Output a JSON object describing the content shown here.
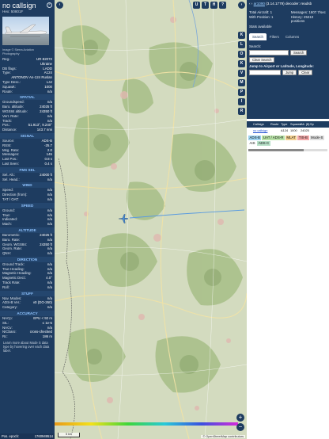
{
  "detail": {
    "callsign": "no callsign",
    "hex": "Hex: 50801F",
    "close_icon": "close-icon",
    "photo_credit": "Image © Sierra Aviation Photography",
    "info_rows": [
      {
        "k": "Reg.:",
        "v": "UR-82072"
      },
      {
        "k": "",
        "v": "Ukraine"
      },
      {
        "k": "DB flags:",
        "v": "LADD"
      },
      {
        "k": "Type:",
        "v": "A124"
      },
      {
        "k": "",
        "v": "ANTONOV An-124 Ruslan"
      },
      {
        "k": "Type Desc.:",
        "v": "L4J"
      },
      {
        "k": "Squawk:",
        "v": "1000"
      },
      {
        "k": "Route:",
        "v": "n/a"
      }
    ],
    "sections": [
      {
        "title": "SPATIAL",
        "rows": [
          {
            "k": "Groundspeed:",
            "v": "n/a"
          },
          {
            "k": "Baro. altitude:",
            "v": "24025 ft"
          },
          {
            "k": "WGS84 altitude:",
            "v": "24350 ft"
          },
          {
            "k": "Vert. Rate:",
            "v": "n/a"
          },
          {
            "k": "Track:",
            "v": "n/a"
          },
          {
            "k": "Pos.:",
            "v": "51.913°, 9.240°"
          },
          {
            "k": "Distance:",
            "v": "143.7 nmi"
          }
        ]
      },
      {
        "title": "SIGNAL",
        "rows": [
          {
            "k": "Source:",
            "v": "ADS-B"
          },
          {
            "k": "RSSI:",
            "v": "-25.7"
          },
          {
            "k": "Msg. Rate:",
            "v": "2.0"
          },
          {
            "k": "Messages:",
            "v": "145"
          },
          {
            "k": "Last Pos.:",
            "v": "0.8 s"
          },
          {
            "k": "Last Seen:",
            "v": "0.4 s"
          }
        ]
      },
      {
        "title": "FMS SEL",
        "rows": [
          {
            "k": "Sel. Alt.:",
            "v": "24000 ft"
          },
          {
            "k": "Sel. Head.:",
            "v": "n/a"
          }
        ]
      },
      {
        "title": "WIND",
        "rows": [
          {
            "k": "Speed:",
            "v": "n/a"
          },
          {
            "k": "Direction (from):",
            "v": "n/a"
          },
          {
            "k": "TAT / OAT:",
            "v": "n/a"
          }
        ]
      },
      {
        "title": "SPEED",
        "rows": [
          {
            "k": "Ground:",
            "v": "n/a"
          },
          {
            "k": "True:",
            "v": "n/a"
          },
          {
            "k": "Indicated:",
            "v": "n/a"
          },
          {
            "k": "Mach:",
            "v": "n/a"
          }
        ]
      },
      {
        "title": "ALTITUDE",
        "rows": [
          {
            "k": "Barometric:",
            "v": "24025 ft"
          },
          {
            "k": "Baro. Rate:",
            "v": "n/a"
          },
          {
            "k": "Geom. WGS84:",
            "v": "24350 ft"
          },
          {
            "k": "Geom. Rate:",
            "v": "n/a"
          },
          {
            "k": "QNH:",
            "v": "n/a"
          }
        ]
      },
      {
        "title": "DIRECTION",
        "rows": [
          {
            "k": "Ground Track:",
            "v": "n/a"
          },
          {
            "k": "True Heading:",
            "v": "n/a"
          },
          {
            "k": "Magnetic Heading:",
            "v": "n/a"
          },
          {
            "k": "Magnetic Decl.:",
            "v": "4.0°"
          },
          {
            "k": "Track Rate:",
            "v": "n/a"
          },
          {
            "k": "Roll:",
            "v": "n/a"
          }
        ]
      },
      {
        "title": "STUFF",
        "rows": [
          {
            "k": "Nav. Modes:",
            "v": "n/a"
          },
          {
            "k": "ADS-B Ver.:",
            "v": "v0 (DO-260)"
          },
          {
            "k": "Category:",
            "v": "n/a"
          }
        ]
      },
      {
        "title": "ACCURACY",
        "rows": [
          {
            "k": "NACp:",
            "v": "EPU < 92 m"
          },
          {
            "k": "SIL:",
            "v": "≤ 1e-5"
          },
          {
            "k": "NACv:",
            "v": "n/a"
          },
          {
            "k": "NICbaro:",
            "v": "cross-checked"
          },
          {
            "k": "Rc:",
            "v": "186 m"
          }
        ]
      }
    ],
    "note": "Learn more about Mode S data type by hovering over each data label.",
    "epoch_label": "Pos. epoch:",
    "epoch_value": "1760949514"
  },
  "map": {
    "buttons_top": [
      "U",
      "T",
      "H",
      "?"
    ],
    "buttons_side": [
      "K",
      "L",
      "O",
      "K",
      "V",
      "M",
      "P",
      "I",
      "R"
    ],
    "zoom_in": "+",
    "zoom_out": "−",
    "scale_label": "5 km",
    "attribution": "© OpenStreetMap contributors",
    "plane_icon": "airplane-icon",
    "colors": {
      "plane": "#4a8fd8",
      "trail": "#5a9be0"
    }
  },
  "panel": {
    "version_prefix": "ar1090",
    "version": "(3.14.1779) decoder: readsb",
    "stats": [
      {
        "k": "Total Aircraft: 1",
        "v": "Messages: 1607.7/sec"
      },
      {
        "k": "With Position: 1",
        "v": "History: 25310 positions"
      },
      {
        "k": "Stats available",
        "v": ""
      }
    ],
    "tabs": [
      "Search",
      "Filters",
      "Columns"
    ],
    "search_label": "Search:",
    "search_button": "Search",
    "clear_search": "Clear Search",
    "jump_label": "Jump to Airport or Latitude, Longitude:",
    "jump_button": "Jump",
    "clear_button": "Clear",
    "table_headers": [
      "",
      "Callsign",
      "Route",
      "Type",
      "Squawk",
      "Alt. (ft)",
      "Sp"
    ],
    "table_rows": [
      [
        "",
        "no callsign",
        "",
        "A124",
        "1000",
        "24025",
        ""
      ]
    ],
    "badges": [
      {
        "label": "ADS-B",
        "color": "#9ed3f0"
      },
      {
        "label": "UAT / ADS-R",
        "color": "#b9e3a8"
      },
      {
        "label": "MLAT",
        "color": "#f3cf8f"
      },
      {
        "label": "TIS-B",
        "color": "#f3a7a7"
      },
      {
        "label": "Mode-S",
        "color": "#e0e0e0"
      },
      {
        "label": "AIS",
        "color": "#ffffff"
      },
      {
        "label": "ADS-C",
        "color": "#b7e0c8"
      }
    ]
  }
}
